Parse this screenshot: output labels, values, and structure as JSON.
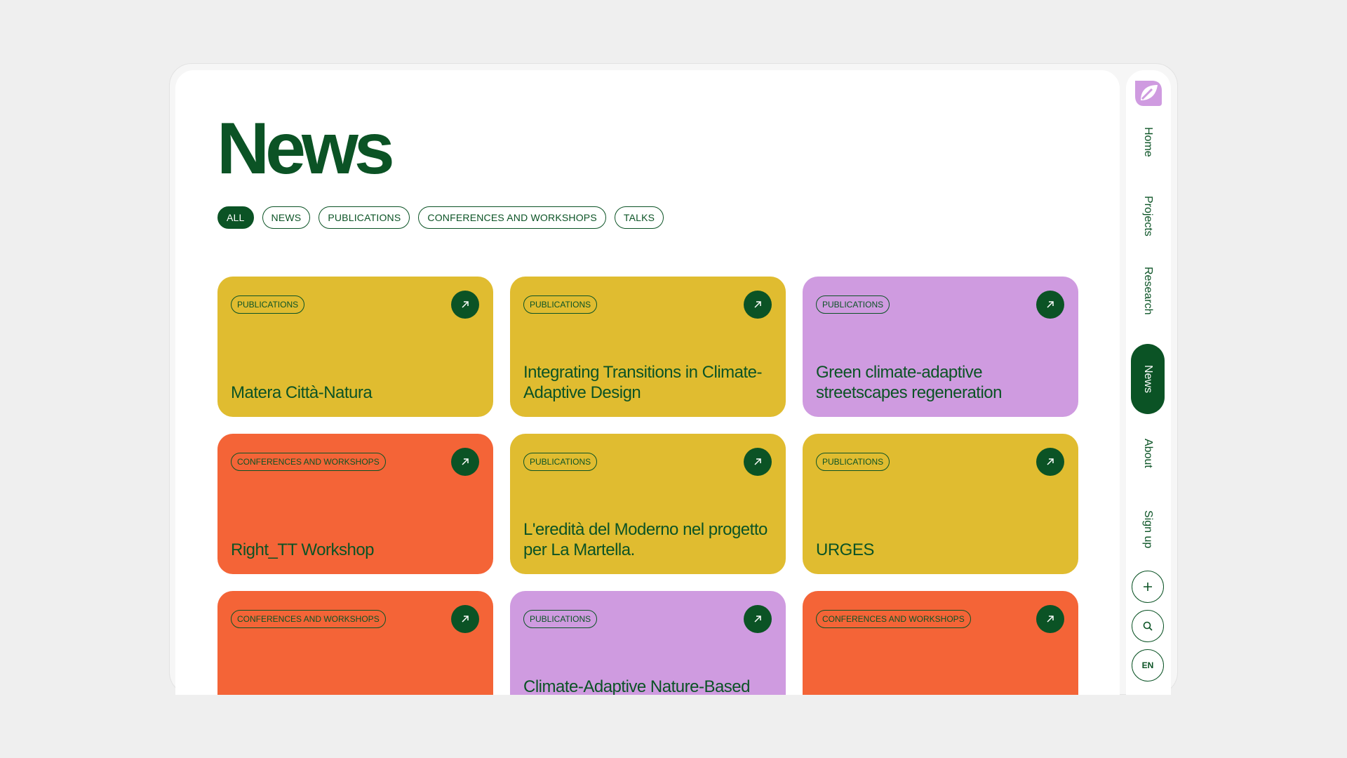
{
  "page": {
    "title": "News"
  },
  "filters": [
    "ALL",
    "NEWS",
    "PUBLICATIONS",
    "CONFERENCES AND WORKSHOPS",
    "TALKS"
  ],
  "active_filter": "ALL",
  "cards": [
    {
      "tag": "PUBLICATIONS",
      "title": "Matera Città-Natura",
      "color": "#e0bc30"
    },
    {
      "tag": "PUBLICATIONS",
      "title": "Integrating Transitions in Climate-Adaptive Design",
      "color": "#e0bc30"
    },
    {
      "tag": "PUBLICATIONS",
      "title": "Green climate-adaptive streetscapes regeneration",
      "color": "#cf9be0"
    },
    {
      "tag": "CONFERENCES AND WORKSHOPS",
      "title": "Right_TT Workshop",
      "color": "#f46437"
    },
    {
      "tag": "PUBLICATIONS",
      "title": "L'eredità del Moderno nel progetto per La Martella.",
      "color": "#e0bc30"
    },
    {
      "tag": "PUBLICATIONS",
      "title": "URGES",
      "color": "#e0bc30"
    },
    {
      "tag": "CONFERENCES AND WORKSHOPS",
      "title": "",
      "color": "#f46437"
    },
    {
      "tag": "PUBLICATIONS",
      "title": "Climate-Adaptive Nature-Based Regenerative Urban Green",
      "color": "#cf9be0"
    },
    {
      "tag": "CONFERENCES AND WORKSHOPS",
      "title": "",
      "color": "#f46437"
    }
  ],
  "sidebar": {
    "nav": [
      "Home",
      "Projects",
      "Research",
      "News",
      "About",
      "Sign up"
    ],
    "active": "News",
    "language": "EN"
  },
  "colors": {
    "brand_green": "#0b5325",
    "logo_purple": "#cf9be0"
  },
  "icons": [
    "logo-icon",
    "arrow-up-right-icon",
    "plus-icon",
    "search-icon"
  ]
}
